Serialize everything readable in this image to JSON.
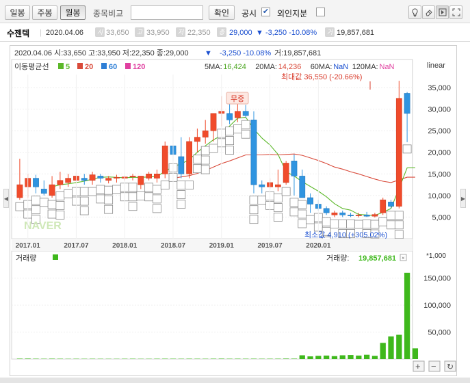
{
  "toolbar": {
    "period_buttons": [
      "일봉",
      "주봉",
      "월봉"
    ],
    "active_period": "월봉",
    "compare_label": "종목비교",
    "compare_value": "",
    "confirm_label": "확인",
    "disclosure_label": "공시",
    "disclosure_checked": true,
    "foreign_label": "외인지분",
    "foreign_checked": false,
    "tool_icons": [
      "lightbulb-icon",
      "eraser-icon",
      "chart-mode-icon",
      "expand-icon"
    ]
  },
  "info": {
    "name": "수젠텍",
    "date": "2020.04.06",
    "open_badge": "시",
    "open": "33,650",
    "high_badge": "고",
    "high": "33,950",
    "low_badge": "저",
    "low": "22,350",
    "close_badge": "종",
    "close": "29,000",
    "change": "▼ -3,250 -10.08%",
    "volume_badge": "거",
    "volume": "19,857,681"
  },
  "chart": {
    "ohlc_line_left": "2020.04.06 시:33,650 고:33,950 저:22,350 종:29,000",
    "ohlc_arrow": "▼",
    "ohlc_change": "-3,250 -10.08%",
    "ohlc_volume": "거:19,857,681",
    "ma_title": "이동평균선",
    "ma_legend": [
      {
        "label": "5",
        "color": "#5cb82a"
      },
      {
        "label": "20",
        "color": "#d94a3a"
      },
      {
        "label": "60",
        "color": "#2e7fd6"
      },
      {
        "label": "120",
        "color": "#e040a0"
      }
    ],
    "ma_values": [
      {
        "name": "5MA:",
        "value": "16,424",
        "color": "#4aa51f"
      },
      {
        "name": "20MA:",
        "value": "14,236",
        "color": "#d94a3a"
      },
      {
        "name": "60MA:",
        "value": "NaN",
        "color": "#1a4fd0"
      },
      {
        "name": "120MA:",
        "value": "NaN",
        "color": "#e040a0"
      }
    ],
    "scale_label": "linear",
    "max_label": "최대값 36,550 (-20.66%)",
    "min_label": "최소값 4,910 (+305.02%)",
    "event_label": "무증",
    "watermark": "NAVER",
    "volume_title": "거래량",
    "volume_value_label": "거래량:",
    "volume_value": "19,857,681",
    "volume_unit": "*1,000",
    "price_ticks": [
      "35,000",
      "30,000",
      "25,000",
      "20,000",
      "15,000",
      "10,000",
      "5,000"
    ],
    "volume_ticks": [
      "150,000",
      "100,000",
      "50,000"
    ],
    "date_ticks": [
      "2017.01",
      "2017.07",
      "2018.01",
      "2018.07",
      "2019.01",
      "2019.07",
      "2020.01"
    ],
    "zoom_buttons": [
      "+",
      "−",
      "↻"
    ],
    "colors": {
      "up": "#f04b2b",
      "down": "#2f94e0",
      "volume": "#3fb81c",
      "ma5": "#5cb82a",
      "ma20": "#d94a3a"
    }
  },
  "chart_data": {
    "type": "candlestick",
    "price_range": [
      0,
      38000
    ],
    "volume_range": [
      0,
      175000
    ],
    "volume_unit": "*1,000",
    "scale": "linear",
    "candles": [
      {
        "o": 9500,
        "h": 18500,
        "l": 9000,
        "c": 12500
      },
      {
        "o": 12000,
        "h": 15000,
        "l": 9500,
        "c": 14000
      },
      {
        "o": 14000,
        "h": 14800,
        "l": 10500,
        "c": 12000
      },
      {
        "o": 11500,
        "h": 13500,
        "l": 10000,
        "c": 10500
      },
      {
        "o": 10000,
        "h": 14500,
        "l": 9500,
        "c": 12500
      },
      {
        "o": 12500,
        "h": 15500,
        "l": 11500,
        "c": 13500
      },
      {
        "o": 13000,
        "h": 15000,
        "l": 12000,
        "c": 14000
      },
      {
        "o": 13500,
        "h": 15500,
        "l": 12500,
        "c": 14500
      },
      {
        "o": 14000,
        "h": 15000,
        "l": 12500,
        "c": 13500
      },
      {
        "o": 13500,
        "h": 15500,
        "l": 12500,
        "c": 14800
      },
      {
        "o": 14500,
        "h": 15000,
        "l": 13000,
        "c": 14000
      },
      {
        "o": 13500,
        "h": 14500,
        "l": 12800,
        "c": 14000
      },
      {
        "o": 14000,
        "h": 14800,
        "l": 13000,
        "c": 14200
      },
      {
        "o": 14000,
        "h": 14600,
        "l": 13500,
        "c": 14300
      },
      {
        "o": 14300,
        "h": 15000,
        "l": 13500,
        "c": 14500
      },
      {
        "o": 12500,
        "h": 14500,
        "l": 11500,
        "c": 14500
      },
      {
        "o": 14000,
        "h": 15500,
        "l": 13500,
        "c": 15000
      },
      {
        "o": 14000,
        "h": 16000,
        "l": 13000,
        "c": 15000
      },
      {
        "o": 15000,
        "h": 22500,
        "l": 14000,
        "c": 21500
      },
      {
        "o": 21500,
        "h": 26000,
        "l": 18000,
        "c": 19500
      },
      {
        "o": 19000,
        "h": 23500,
        "l": 14000,
        "c": 15000
      },
      {
        "o": 15000,
        "h": 23500,
        "l": 14000,
        "c": 22500
      },
      {
        "o": 22500,
        "h": 25500,
        "l": 20000,
        "c": 23500
      },
      {
        "o": 23500,
        "h": 27500,
        "l": 22000,
        "c": 25000
      },
      {
        "o": 25000,
        "h": 29000,
        "l": 22500,
        "c": 29000
      },
      {
        "o": 29000,
        "h": 33000,
        "l": 26000,
        "c": 29500
      },
      {
        "o": 29000,
        "h": 31500,
        "l": 26500,
        "c": 27500
      },
      {
        "o": 28000,
        "h": 34000,
        "l": 27000,
        "c": 29500
      },
      {
        "o": 29500,
        "h": 31000,
        "l": 28000,
        "c": 28500
      },
      {
        "o": 27500,
        "h": 29500,
        "l": 10500,
        "c": 12500
      },
      {
        "o": 12500,
        "h": 13500,
        "l": 10500,
        "c": 12000
      },
      {
        "o": 12000,
        "h": 14000,
        "l": 11500,
        "c": 13000
      },
      {
        "o": 12000,
        "h": 16000,
        "l": 11000,
        "c": 12500
      },
      {
        "o": 13000,
        "h": 18000,
        "l": 12500,
        "c": 17500
      },
      {
        "o": 18000,
        "h": 19500,
        "l": 10000,
        "c": 14500
      },
      {
        "o": 14500,
        "h": 16000,
        "l": 9500,
        "c": 9500
      },
      {
        "o": 9500,
        "h": 10500,
        "l": 6000,
        "c": 8000
      },
      {
        "o": 8000,
        "h": 9000,
        "l": 6500,
        "c": 7000
      },
      {
        "o": 7000,
        "h": 7500,
        "l": 5500,
        "c": 6000
      },
      {
        "o": 5500,
        "h": 6500,
        "l": 5000,
        "c": 6000
      },
      {
        "o": 6000,
        "h": 6500,
        "l": 5000,
        "c": 5500
      },
      {
        "o": 5500,
        "h": 6000,
        "l": 5000,
        "c": 5300
      },
      {
        "o": 5300,
        "h": 6000,
        "l": 4910,
        "c": 5500
      },
      {
        "o": 5500,
        "h": 6200,
        "l": 5000,
        "c": 5200
      },
      {
        "o": 5200,
        "h": 6000,
        "l": 4910,
        "c": 5600
      },
      {
        "o": 6000,
        "h": 9500,
        "l": 5500,
        "c": 9000
      },
      {
        "o": 8500,
        "h": 9000,
        "l": 7000,
        "c": 7500
      },
      {
        "o": 7500,
        "h": 36550,
        "l": 7000,
        "c": 32500
      },
      {
        "o": 33650,
        "h": 33950,
        "l": 22350,
        "c": 29000
      }
    ],
    "volumes": [
      800,
      900,
      700,
      600,
      750,
      650,
      500,
      600,
      550,
      600,
      550,
      500,
      500,
      600,
      650,
      500,
      550,
      650,
      700,
      650,
      600,
      700,
      650,
      600,
      700,
      800,
      650,
      700,
      650,
      700,
      600,
      650,
      700,
      900,
      800,
      7000,
      5000,
      6000,
      6500,
      5500,
      7000,
      7500,
      6500,
      8000,
      6000,
      30000,
      42000,
      45000,
      160000,
      19857
    ],
    "ma5": [
      null,
      null,
      null,
      null,
      12000,
      12500,
      12700,
      13000,
      13300,
      13800,
      14200,
      14300,
      14200,
      14100,
      14200,
      14200,
      14300,
      14400,
      15600,
      16700,
      17300,
      18300,
      20000,
      21500,
      22900,
      23900,
      26100,
      27900,
      28100,
      25400,
      23300,
      21700,
      19500,
      15500,
      14500,
      13200,
      12100,
      11000,
      9700,
      8100,
      7000,
      6600,
      5600,
      5500,
      5400,
      6100,
      7000,
      11600,
      16400,
      16424
    ],
    "ma20": [
      null,
      null,
      null,
      null,
      null,
      null,
      null,
      null,
      null,
      null,
      null,
      null,
      null,
      null,
      null,
      null,
      null,
      null,
      null,
      14000,
      14300,
      14600,
      15100,
      15800,
      16600,
      17400,
      18000,
      18700,
      19400,
      19400,
      19400,
      19500,
      19400,
      19500,
      19600,
      19300,
      18700,
      18100,
      17400,
      16600,
      16100,
      15500,
      15000,
      14400,
      13800,
      13300,
      13000,
      13600,
      14236,
      14236
    ]
  }
}
